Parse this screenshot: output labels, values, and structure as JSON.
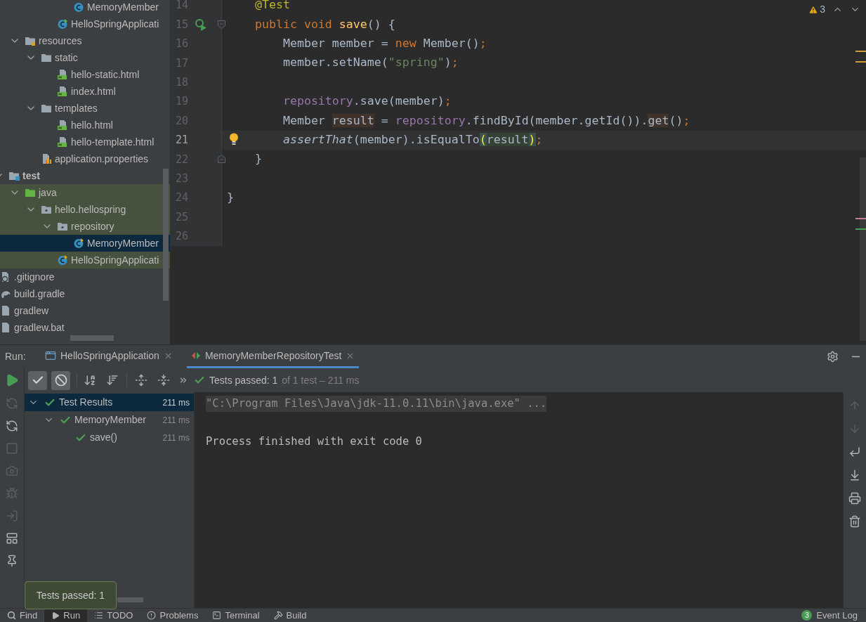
{
  "tree": [
    {
      "children": [
        {
          "children": [
            {
              "children": [
                {
                  "children": [
                    {
                      "children": [
                        {
                          "name": "MemoryMember",
                          "kind": "class",
                          "selected": false,
                          "highlighted": false
                        }
                      ]
                    },
                    {
                      "name": "HelloSpringApplicati",
                      "kind": "app-class",
                      "selected": false,
                      "highlighted": false
                    }
                  ]
                }
              ]
            },
            {
              "name": "resources",
              "kind": "resources-folder",
              "expanded": true,
              "selected": false,
              "highlighted": false,
              "children": [
                {
                  "name": "static",
                  "kind": "folder",
                  "expanded": true,
                  "selected": false,
                  "highlighted": false,
                  "children": [
                    {
                      "name": "hello-static.html",
                      "kind": "html",
                      "selected": false,
                      "highlighted": false
                    },
                    {
                      "name": "index.html",
                      "kind": "html",
                      "selected": false,
                      "highlighted": false
                    }
                  ]
                },
                {
                  "name": "templates",
                  "kind": "folder",
                  "expanded": true,
                  "selected": false,
                  "highlighted": false,
                  "children": [
                    {
                      "name": "hello.html",
                      "kind": "html",
                      "selected": false,
                      "highlighted": false
                    },
                    {
                      "name": "hello-template.html",
                      "kind": "html",
                      "selected": false,
                      "highlighted": false
                    }
                  ]
                },
                {
                  "name": "application.properties",
                  "kind": "properties",
                  "selected": false,
                  "highlighted": false
                }
              ]
            }
          ]
        },
        {
          "name": "test",
          "kind": "test-root",
          "expanded": true,
          "selected": false,
          "highlighted": false,
          "children": [
            {
              "name": "java",
              "kind": "test-folder",
              "expanded": true,
              "selected": false,
              "highlighted": true,
              "children": [
                {
                  "name": "hello.hellospring",
                  "kind": "package",
                  "expanded": true,
                  "selected": false,
                  "highlighted": true,
                  "children": [
                    {
                      "name": "repository",
                      "kind": "package",
                      "expanded": true,
                      "selected": false,
                      "highlighted": true,
                      "children": [
                        {
                          "name": "MemoryMember",
                          "kind": "test-class",
                          "selected": true,
                          "highlighted": true
                        }
                      ]
                    },
                    {
                      "name": "HelloSpringApplicati",
                      "kind": "test-class",
                      "selected": false,
                      "highlighted": true
                    }
                  ]
                }
              ]
            }
          ]
        }
      ]
    },
    {
      "name": ".gitignore",
      "kind": "ignore-file",
      "selected": false,
      "highlighted": false
    },
    {
      "name": "build.gradle",
      "kind": "gradle",
      "selected": false,
      "highlighted": false
    },
    {
      "name": "gradlew",
      "kind": "file",
      "selected": false,
      "highlighted": false
    },
    {
      "name": "gradlew.bat",
      "kind": "file",
      "selected": false,
      "highlighted": false
    }
  ],
  "editor": {
    "inspections": {
      "count": "3"
    },
    "lines": [
      {
        "number": "14",
        "kind": "plain",
        "current": false,
        "tokens": [
          {
            "text": "    @Test",
            "kind": "annotation"
          }
        ]
      },
      {
        "number": "15",
        "kind": "test-start",
        "current": false,
        "tokens": [
          {
            "text": "    public void ",
            "kind": "keyword"
          },
          {
            "text": "save",
            "kind": "method"
          },
          {
            "text": "() {",
            "kind": "plain"
          }
        ]
      },
      {
        "number": "16",
        "kind": "plain",
        "current": false,
        "tokens": [
          {
            "text": "        Member member = ",
            "kind": "plain"
          },
          {
            "text": "new ",
            "kind": "keyword"
          },
          {
            "text": "Member()",
            "kind": "plain"
          },
          {
            "text": ";",
            "kind": "keyword"
          }
        ]
      },
      {
        "number": "17",
        "kind": "plain",
        "current": false,
        "tokens": [
          {
            "text": "        member.setName(",
            "kind": "plain"
          },
          {
            "text": "\"spring\"",
            "kind": "string"
          },
          {
            "text": ")",
            "kind": "plain"
          },
          {
            "text": ";",
            "kind": "keyword"
          }
        ]
      },
      {
        "number": "18",
        "kind": "plain",
        "current": false
      },
      {
        "number": "19",
        "kind": "plain",
        "current": false,
        "tokens": [
          {
            "text": "        repository",
            "kind": "field"
          },
          {
            "text": ".save(member)",
            "kind": "plain"
          },
          {
            "text": ";",
            "kind": "keyword"
          }
        ]
      },
      {
        "number": "20",
        "kind": "plain",
        "current": false,
        "tokens": [
          {
            "text": "        Member ",
            "kind": "plain"
          },
          {
            "text": "result",
            "kind": "usage"
          },
          {
            "text": " = ",
            "kind": "plain"
          },
          {
            "text": "repository",
            "kind": "field"
          },
          {
            "text": ".findById(member.getId()).",
            "kind": "plain"
          },
          {
            "text": "get",
            "kind": "usage"
          },
          {
            "text": "()",
            "kind": "plain"
          },
          {
            "text": ";",
            "kind": "keyword"
          }
        ]
      },
      {
        "number": "21",
        "kind": "intention",
        "current": true,
        "tokens": [
          {
            "text": "        assertThat",
            "kind": "italic"
          },
          {
            "text": "(member).isEqualTo",
            "kind": "plain"
          },
          {
            "text": "(",
            "kind": "brace"
          },
          {
            "text": "result",
            "kind": "matched"
          },
          {
            "text": ")",
            "kind": "brace"
          },
          {
            "text": ";",
            "kind": "keyword"
          }
        ]
      },
      {
        "number": "22",
        "kind": "block-end",
        "current": false,
        "tokens": [
          {
            "text": "    }",
            "kind": "plain"
          }
        ]
      },
      {
        "number": "23",
        "kind": "plain",
        "current": false
      },
      {
        "number": "24",
        "kind": "plain",
        "current": false,
        "tokens": [
          {
            "text": "}",
            "kind": "plain"
          }
        ]
      },
      {
        "number": "25",
        "kind": "plain",
        "current": false
      },
      {
        "number": "26",
        "kind": "plain",
        "current": false
      }
    ]
  },
  "run_panel": {
    "label": "Run:",
    "tabs": [
      {
        "label": "HelloSpringApplication",
        "kind": "app",
        "selected": false
      },
      {
        "label": "MemoryMemberRepositoryTest",
        "kind": "test",
        "selected": true
      }
    ],
    "toggles": [
      {
        "kind": "passed",
        "on": true
      },
      {
        "kind": "ignored",
        "on": true
      }
    ],
    "summary": {
      "text": "Tests passed: 1",
      "detail": "of 1 test – 211 ms"
    },
    "results": [
      {
        "name": "Test Results",
        "time": "211 ms",
        "selected": true,
        "expanded": true,
        "children": [
          {
            "name": "MemoryMember",
            "time": "211 ms",
            "selected": false,
            "expanded": true,
            "children": [
              {
                "name": "save()",
                "time": "211 ms",
                "selected": false
              }
            ]
          }
        ]
      }
    ],
    "console": [
      {
        "text": "\"C:\\Program Files\\Java\\jdk-11.0.11\\bin\\java.exe\" ...",
        "kind": "folded"
      },
      {
        "text": "Process finished with exit code 0",
        "kind": "exit"
      }
    ]
  },
  "tooltip": {
    "text": "Tests passed: 1"
  },
  "bottom_bar": {
    "items": [
      {
        "label": "Find",
        "kind": "find",
        "selected": false
      },
      {
        "label": "Run",
        "kind": "run",
        "selected": true
      },
      {
        "label": "TODO",
        "kind": "todo",
        "selected": false
      },
      {
        "label": "Problems",
        "kind": "problems",
        "selected": false
      },
      {
        "label": "Terminal",
        "kind": "terminal",
        "selected": false
      },
      {
        "label": "Build",
        "kind": "build",
        "selected": false
      }
    ],
    "event_log": {
      "label": "Event Log",
      "badge": "3"
    }
  }
}
